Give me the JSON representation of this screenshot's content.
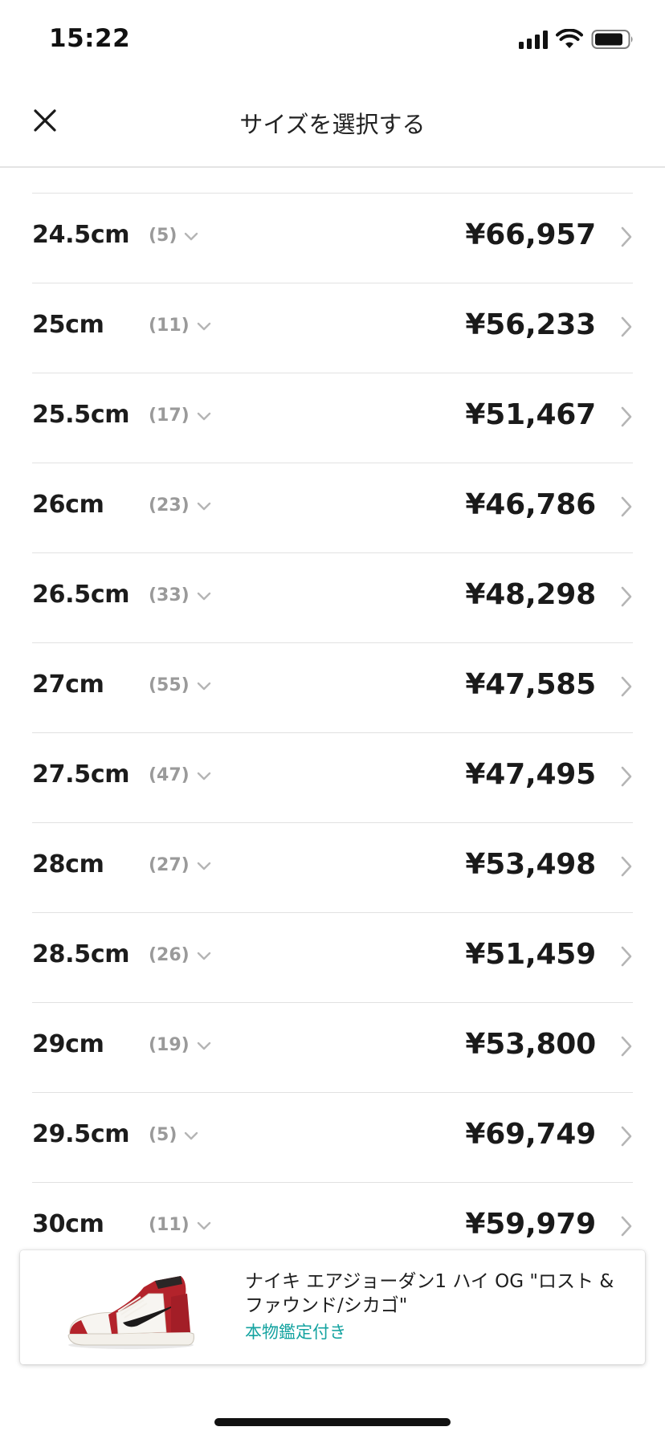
{
  "status_bar": {
    "time": "15:22"
  },
  "header": {
    "title": "サイズを選択する",
    "close_icon": "close-icon"
  },
  "sizes": [
    {
      "size": "24.5cm",
      "count": "(5)",
      "price": "¥66,957"
    },
    {
      "size": "25cm",
      "count": "(11)",
      "price": "¥56,233"
    },
    {
      "size": "25.5cm",
      "count": "(17)",
      "price": "¥51,467"
    },
    {
      "size": "26cm",
      "count": "(23)",
      "price": "¥46,786"
    },
    {
      "size": "26.5cm",
      "count": "(33)",
      "price": "¥48,298"
    },
    {
      "size": "27cm",
      "count": "(55)",
      "price": "¥47,585"
    },
    {
      "size": "27.5cm",
      "count": "(47)",
      "price": "¥47,495"
    },
    {
      "size": "28cm",
      "count": "(27)",
      "price": "¥53,498"
    },
    {
      "size": "28.5cm",
      "count": "(26)",
      "price": "¥51,459"
    },
    {
      "size": "29cm",
      "count": "(19)",
      "price": "¥53,800"
    },
    {
      "size": "29.5cm",
      "count": "(5)",
      "price": "¥69,749"
    },
    {
      "size": "30cm",
      "count": "(11)",
      "price": "¥59,979"
    }
  ],
  "product": {
    "name": "ナイキ エアジョーダン1 ハイ OG \"ロスト & ファウンド/シカゴ\"",
    "badge": "本物鑑定付き",
    "image_icon": "sneaker-image"
  },
  "colors": {
    "accent_teal": "#14a3a0",
    "text_primary": "#1a1a1a",
    "text_muted": "#9a9a9a",
    "divider": "#e1e1e1"
  }
}
